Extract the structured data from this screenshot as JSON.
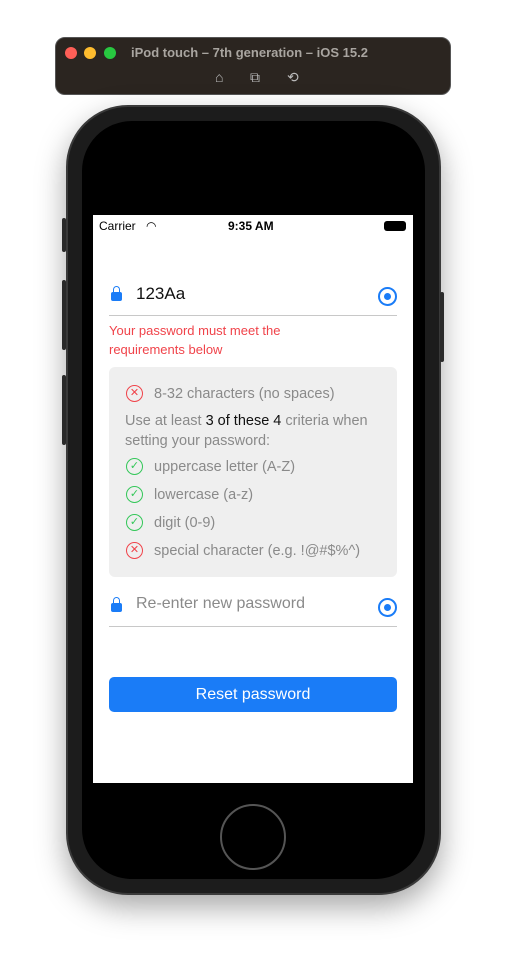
{
  "window": {
    "title": "iPod touch – 7th generation – iOS 15.2"
  },
  "status_bar": {
    "carrier": "Carrier",
    "time": "9:35 AM"
  },
  "password_field": {
    "value": "123Aa"
  },
  "error_message": "Your password must meet the requirements below",
  "requirements": {
    "length": {
      "label": "8-32 characters (no spaces)",
      "met": false
    },
    "note_prefix": "Use at least ",
    "note_bold": "3 of these 4",
    "note_suffix": " criteria when setting your password:",
    "criteria": [
      {
        "label": "uppercase letter (A-Z)",
        "met": true
      },
      {
        "label": "lowercase (a-z)",
        "met": true
      },
      {
        "label": "digit (0-9)",
        "met": true
      },
      {
        "label": "special character (e.g. !@#$%^)",
        "met": false
      }
    ]
  },
  "confirm_field": {
    "placeholder": "Re-enter new password"
  },
  "reset_button": "Reset password",
  "colors": {
    "accent": "#1a7cf7",
    "error": "#f0434a",
    "success": "#34c759"
  }
}
